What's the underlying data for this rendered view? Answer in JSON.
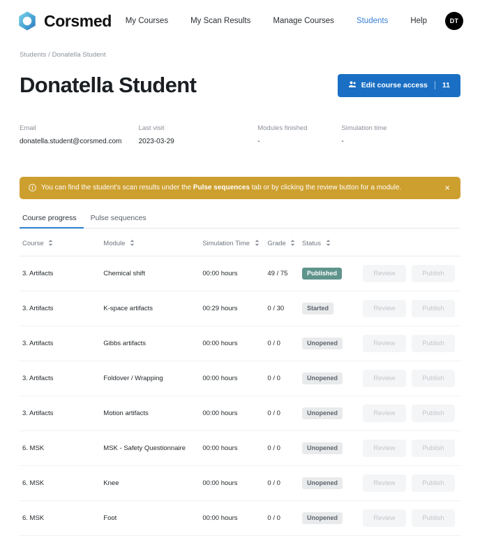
{
  "navbar": {
    "brand_name": "Corsmed",
    "links": [
      {
        "label": "My Courses",
        "active": false
      },
      {
        "label": "My Scan Results",
        "active": false
      },
      {
        "label": "Manage Courses",
        "active": false
      },
      {
        "label": "Students",
        "active": true
      },
      {
        "label": "Help",
        "active": false
      }
    ],
    "avatar_initials": "DT"
  },
  "breadcrumb": {
    "parent": "Students",
    "separator": "/",
    "current": "Donatella Student"
  },
  "header": {
    "title": "Donatella Student",
    "edit_access_label": "Edit course access",
    "edit_access_count": "11"
  },
  "meta": [
    {
      "label": "Email",
      "value": "donatella.student@corsmed.com"
    },
    {
      "label": "Last visit",
      "value": "2023-03-29"
    },
    {
      "label": "Modules finished",
      "value": "-"
    },
    {
      "label": "Simulation time",
      "value": "-"
    }
  ],
  "alert": {
    "text_before": "You can find the student's scan results under the",
    "text_bold": "Pulse sequences",
    "text_after": "tab or by clicking the review button for a module.",
    "close_label": "×",
    "background_color": "#cd9f2e"
  },
  "tabs": [
    {
      "label": "Course progress",
      "active": true
    },
    {
      "label": "Pulse sequences",
      "active": false
    }
  ],
  "table": {
    "headers": [
      "Course",
      "Module",
      "Simulation Time",
      "Grade",
      "Status",
      "",
      ""
    ],
    "review_label": "Review",
    "publish_label": "Publish",
    "rows": [
      {
        "course": "3. Artifacts",
        "module": "Chemical shift",
        "time": "00:00 hours",
        "grade": "49 / 75",
        "status": "Published",
        "status_kind": "published"
      },
      {
        "course": "3. Artifacts",
        "module": "K-space artifacts",
        "time": "00:29 hours",
        "grade": "0 / 30",
        "status": "Started",
        "status_kind": "started"
      },
      {
        "course": "3. Artifacts",
        "module": "Gibbs artifacts",
        "time": "00:00 hours",
        "grade": "0 / 0",
        "status": "Unopened",
        "status_kind": "unopened"
      },
      {
        "course": "3. Artifacts",
        "module": "Foldover / Wrapping",
        "time": "00:00 hours",
        "grade": "0 / 0",
        "status": "Unopened",
        "status_kind": "unopened"
      },
      {
        "course": "3. Artifacts",
        "module": "Motion artifacts",
        "time": "00:00 hours",
        "grade": "0 / 0",
        "status": "Unopened",
        "status_kind": "unopened"
      },
      {
        "course": "6. MSK",
        "module": "MSK - Safety Questionnaire",
        "time": "00:00 hours",
        "grade": "0 / 0",
        "status": "Unopened",
        "status_kind": "unopened"
      },
      {
        "course": "6. MSK",
        "module": "Knee",
        "time": "00:00 hours",
        "grade": "0 / 0",
        "status": "Unopened",
        "status_kind": "unopened"
      },
      {
        "course": "6. MSK",
        "module": "Foot",
        "time": "00:00 hours",
        "grade": "0 / 0",
        "status": "Unopened",
        "status_kind": "unopened"
      }
    ]
  },
  "colors": {
    "brand_blue": "#1a6fc4",
    "nav_active": "#3b82d6",
    "alert_gold": "#cd9f2e",
    "badge_published": "#5f948c",
    "badge_muted": "#e9eaec"
  }
}
